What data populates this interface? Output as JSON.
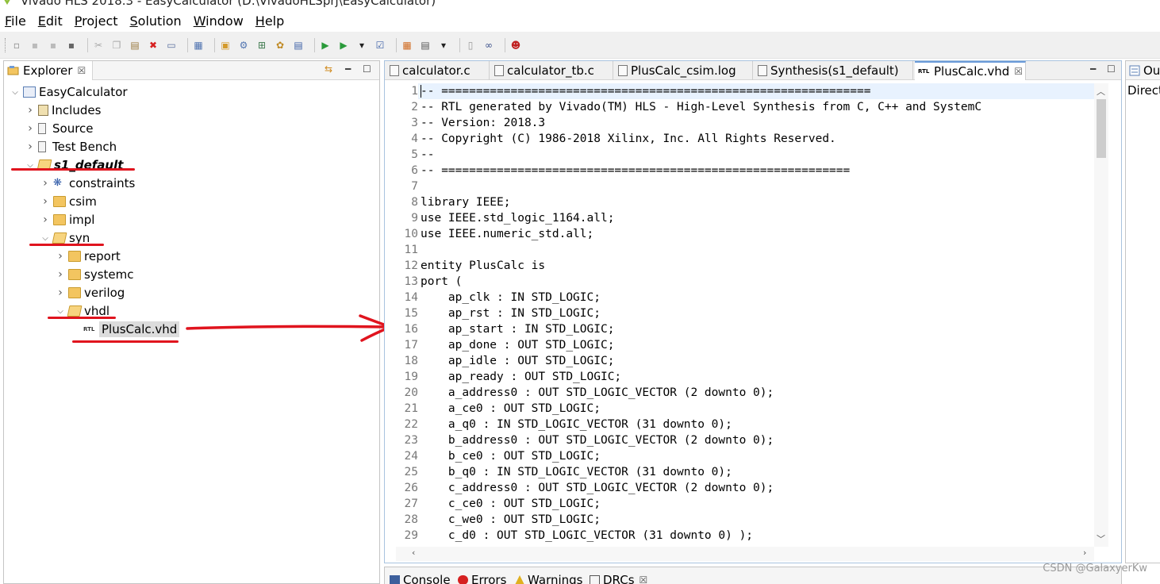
{
  "window": {
    "title": "Vivado HLS 2018.3 - EasyCalculator (D:\\VivadoHLSprj\\EasyCalculator)"
  },
  "menu": [
    {
      "label": "File",
      "key": "F",
      "rest": "ile"
    },
    {
      "label": "Edit",
      "key": "E",
      "rest": "dit"
    },
    {
      "label": "Project",
      "key": "P",
      "rest": "roject"
    },
    {
      "label": "Solution",
      "key": "S",
      "rest": "olution"
    },
    {
      "label": "Window",
      "key": "W",
      "rest": "indow"
    },
    {
      "label": "Help",
      "key": "H",
      "rest": "elp"
    }
  ],
  "toolbar": {
    "icons": [
      "new-icon",
      "save-icon",
      "save-all-icon",
      "save-as-icon",
      "cut-icon",
      "copy-icon",
      "paste-icon",
      "delete-icon",
      "print-icon",
      "project-settings-icon",
      "new-solution-icon",
      "solution-settings-icon",
      "index-source-icon",
      "directive-icon",
      "csim-icon",
      "synthesis-icon",
      "run-icon",
      "run-dropdown-icon",
      "cosim-icon",
      "export-rtl-icon",
      "open-report-icon",
      "report-dropdown-icon",
      "compare-icon",
      "analysis-icon",
      "debug-icon"
    ]
  },
  "explorer": {
    "tab_label": "Explorer",
    "close": "☒",
    "tree": [
      {
        "label": "EasyCalculator",
        "level": 0,
        "expanded": true,
        "icon": "project-icon"
      },
      {
        "label": "Includes",
        "level": 1,
        "expanded": false,
        "icon": "includes-icon"
      },
      {
        "label": "Source",
        "level": 1,
        "expanded": false,
        "icon": "source-icon"
      },
      {
        "label": "Test Bench",
        "level": 1,
        "expanded": false,
        "icon": "testbench-icon"
      },
      {
        "label": "s1_default",
        "level": 1,
        "expanded": true,
        "icon": "solution-folder-icon",
        "bold": true
      },
      {
        "label": "constraints",
        "level": 2,
        "expanded": false,
        "icon": "constraints-icon"
      },
      {
        "label": "csim",
        "level": 2,
        "expanded": false,
        "icon": "folder-icon"
      },
      {
        "label": "impl",
        "level": 2,
        "expanded": false,
        "icon": "folder-icon"
      },
      {
        "label": "syn",
        "level": 2,
        "expanded": true,
        "icon": "folder-open-icon"
      },
      {
        "label": "report",
        "level": 3,
        "expanded": false,
        "icon": "folder-icon"
      },
      {
        "label": "systemc",
        "level": 3,
        "expanded": false,
        "icon": "folder-icon"
      },
      {
        "label": "verilog",
        "level": 3,
        "expanded": false,
        "icon": "folder-icon"
      },
      {
        "label": "vhdl",
        "level": 3,
        "expanded": true,
        "icon": "folder-open-icon"
      },
      {
        "label": "PlusCalc.vhd",
        "level": 4,
        "leaf": true,
        "icon": "rtl-file-icon",
        "selected": true
      }
    ]
  },
  "editor": {
    "tabs": [
      {
        "label": "calculator.c",
        "icon": "c-file-icon",
        "active": false
      },
      {
        "label": "calculator_tb.c",
        "icon": "c-file-icon",
        "active": false
      },
      {
        "label": "PlusCalc_csim.log",
        "icon": "log-file-icon",
        "active": false
      },
      {
        "label": "Synthesis(s1_default)",
        "icon": "report-icon",
        "active": false
      },
      {
        "label": "PlusCalc.vhd",
        "icon": "rtl-file-icon",
        "active": true,
        "close": "☒"
      }
    ],
    "lines": [
      "-- ==============================================================",
      "-- RTL generated by Vivado(TM) HLS - High-Level Synthesis from C, C++ and SystemC",
      "-- Version: 2018.3",
      "-- Copyright (C) 1986-2018 Xilinx, Inc. All Rights Reserved.",
      "--",
      "-- ===========================================================",
      "",
      "library IEEE;",
      "use IEEE.std_logic_1164.all;",
      "use IEEE.numeric_std.all;",
      "",
      "entity PlusCalc is",
      "port (",
      "    ap_clk : IN STD_LOGIC;",
      "    ap_rst : IN STD_LOGIC;",
      "    ap_start : IN STD_LOGIC;",
      "    ap_done : OUT STD_LOGIC;",
      "    ap_idle : OUT STD_LOGIC;",
      "    ap_ready : OUT STD_LOGIC;",
      "    a_address0 : OUT STD_LOGIC_VECTOR (2 downto 0);",
      "    a_ce0 : OUT STD_LOGIC;",
      "    a_q0 : IN STD_LOGIC_VECTOR (31 downto 0);",
      "    b_address0 : OUT STD_LOGIC_VECTOR (2 downto 0);",
      "    b_ce0 : OUT STD_LOGIC;",
      "    b_q0 : IN STD_LOGIC_VECTOR (31 downto 0);",
      "    c_address0 : OUT STD_LOGIC_VECTOR (2 downto 0);",
      "    c_ce0 : OUT STD_LOGIC;",
      "    c_we0 : OUT STD_LOGIC;",
      "    c_d0 : OUT STD_LOGIC_VECTOR (31 downto 0) );"
    ]
  },
  "outline": {
    "tab_label": "Ou",
    "content": "Direct"
  },
  "console_panel": {
    "tabs": [
      "Console",
      "Errors",
      "Warnings",
      "DRCs"
    ],
    "close": "☒"
  },
  "watermark": "CSDN @GalaxyerKw",
  "colors": {
    "annotation_red": "#e0141e",
    "line_highlight": "#e8f2fe",
    "active_tab_border": "#a9c3df"
  }
}
